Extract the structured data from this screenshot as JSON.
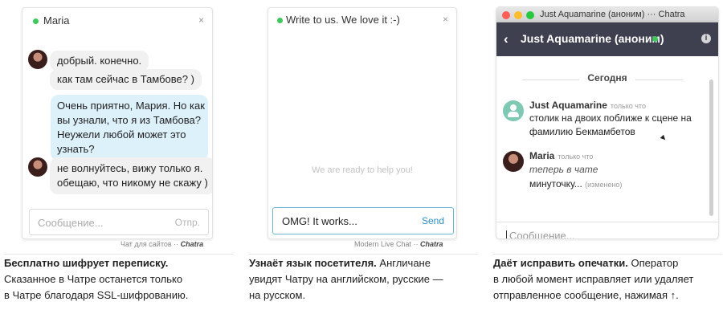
{
  "panels": [
    {
      "header": {
        "name": "Maria",
        "close": "×"
      },
      "messages": [
        "добрый. конечно.",
        "как там сейчас в Тамбове? )",
        "Очень приятно, Мария. Но как",
        "вы узнали, что я из Тамбова?",
        "Неужели любой может это",
        "узнать?",
        "не волнуйтесь, вижу только я.",
        "обещаю, что никому не скажу )"
      ],
      "input": {
        "placeholder": "Сообщение...",
        "send": "Отпр."
      },
      "footer": {
        "text": "Чат для сайтов ·· ",
        "brand": "Chatra"
      }
    },
    {
      "header": {
        "name": "Write to us. We love it :-)",
        "close": "×"
      },
      "hint": "We are ready to help you!",
      "input": {
        "value": "OMG! It works...",
        "send": "Send"
      },
      "footer": {
        "text": "Modern Live Chat ·· ",
        "brand": "Chatra"
      }
    },
    {
      "window_title": "Just Aquamarine (аноним) ··· Chatra",
      "header_title": "Just Aquamarine (аноним)",
      "info": "i",
      "date": "Сегодня",
      "messages": [
        {
          "sender": "Just Aquamarine",
          "time": "только что",
          "lines": [
            "столик на двоих поближе к сцене на",
            "фамилию Бекмамбетов"
          ]
        },
        {
          "sender": "Maria",
          "time": "только что",
          "typing": "теперь в чате",
          "line": "минуточку...",
          "edited": "(изменено)"
        }
      ],
      "input": {
        "placeholder": "Сообщение..."
      }
    }
  ],
  "captions": [
    {
      "bold": "Бесплатно шифрует переписку.",
      "lines": [
        "Сказанное в Чатре останется только",
        "в Чатре благодаря SSL-шифрованию."
      ]
    },
    {
      "bold": "Узнаёт язык посетителя.",
      "rest": " Англичане",
      "lines": [
        "увидят Чатру на английском, русские —",
        "на русском."
      ]
    },
    {
      "bold": "Даёт исправить опечатки.",
      "rest": " Оператор",
      "lines": [
        "в любой момент исправляет или удаляет",
        "отправленное сообщение, нажимая ↑."
      ]
    }
  ],
  "colors": {
    "online": "#3ec75a",
    "dark_header": "#3e4050",
    "outgoing_bubble": "#ddf1fb",
    "agent_icon": "#7fc9b4"
  }
}
